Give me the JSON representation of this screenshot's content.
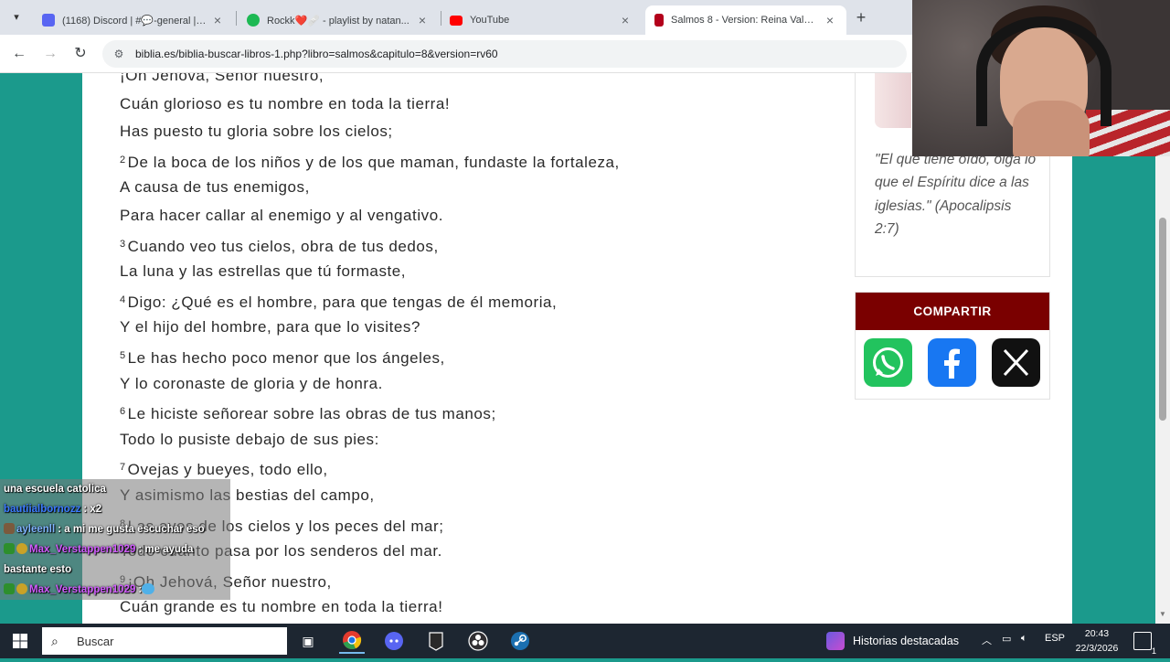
{
  "browser": {
    "tabs": [
      {
        "label": "(1168) Discord | #💬-general | ...",
        "favicon_color": "#5865f2"
      },
      {
        "label": "Rockk❤️🩹 - playlist by natan...",
        "favicon_color": "#1db954"
      },
      {
        "label": "YouTube",
        "favicon_color": "#ff0000"
      },
      {
        "label": "Salmos 8 - Version: Reina Valera...",
        "favicon_color": "#b3001b"
      }
    ],
    "new_tab_glyph": "+",
    "url": "biblia.es/biblia-buscar-libros-1.php?libro=salmos&capitulo=8&version=rv60"
  },
  "verses": [
    {
      "num": "",
      "text": "¡Oh Jehová, Señor nuestro,"
    },
    {
      "num": "",
      "text": "Cuán glorioso es tu nombre en toda la tierra!"
    },
    {
      "num": "",
      "text": "Has puesto tu gloria sobre los cielos;"
    },
    {
      "num": "2",
      "text": "De la boca de los niños y de los que maman, fundaste la fortaleza,"
    },
    {
      "num": "",
      "text": "A causa de tus enemigos,"
    },
    {
      "num": "",
      "text": "Para hacer callar al enemigo y al vengativo."
    },
    {
      "num": "3",
      "text": "Cuando veo tus cielos, obra de tus dedos,"
    },
    {
      "num": "",
      "text": "La luna y las estrellas que tú formaste,"
    },
    {
      "num": "4",
      "text": "Digo: ¿Qué es el hombre, para que tengas de él memoria,"
    },
    {
      "num": "",
      "text": "Y el hijo del hombre, para que lo visites?"
    },
    {
      "num": "5",
      "text": "Le has hecho poco menor que los ángeles,"
    },
    {
      "num": "",
      "text": "Y lo coronaste de gloria y de honra."
    },
    {
      "num": "6",
      "text": "Le hiciste señorear sobre las obras de tus manos;"
    },
    {
      "num": "",
      "text": "Todo lo pusiste debajo de sus pies:"
    },
    {
      "num": "7",
      "text": "Ovejas y bueyes, todo ello,"
    },
    {
      "num": "",
      "text": "Y asimismo las bestias del campo,"
    },
    {
      "num": "8",
      "text": "Las aves de los cielos y los peces del mar;"
    },
    {
      "num": "",
      "text": "Todo cuanto pasa por los senderos del mar."
    },
    {
      "num": "9",
      "text": "¡Oh Jehová, Señor nuestro,"
    },
    {
      "num": "",
      "text": "Cuán grande es tu nombre en toda la tierra!"
    }
  ],
  "sidebar": {
    "quote": "\"El que tiene oído, oiga lo que el Espíritu dice a las iglesias.\" (Apocalipsis 2:7)",
    "share_title": "COMPARTIR",
    "share_buttons": [
      "whatsapp-icon",
      "facebook-icon",
      "x-icon"
    ]
  },
  "chat": [
    {
      "user": "",
      "user_color": "#ffffff",
      "text": "una escuela catolica",
      "badges": []
    },
    {
      "user": "bautiialbornozz",
      "user_color": "#3b7bff",
      "text": ": x2",
      "badges": []
    },
    {
      "user": "ayleenll",
      "user_color": "#7fb4ff",
      "text": ": a mi me gusta escuchar eso",
      "badges": [
        "avatar"
      ]
    },
    {
      "user": "Max_Verstappen1029",
      "user_color": "#d25cff",
      "text": ": me ayuda",
      "badges": [
        "mod",
        "gold"
      ]
    },
    {
      "user": "",
      "user_color": "#ffffff",
      "text": "bastante esto",
      "badges": []
    },
    {
      "user": "Max_Verstappen1029",
      "user_color": "#d25cff",
      "text": ":",
      "badges": [
        "mod",
        "gold"
      ]
    }
  ],
  "taskbar": {
    "search_placeholder": "Buscar",
    "news_label": "Historias destacadas",
    "language": "ESP",
    "time": "20:43",
    "date": "22/3/2026",
    "notification_count": "1"
  },
  "colors": {
    "page_bg": "#1b9a8c",
    "share_header": "#7a0000",
    "taskbar": "#1d2631"
  }
}
